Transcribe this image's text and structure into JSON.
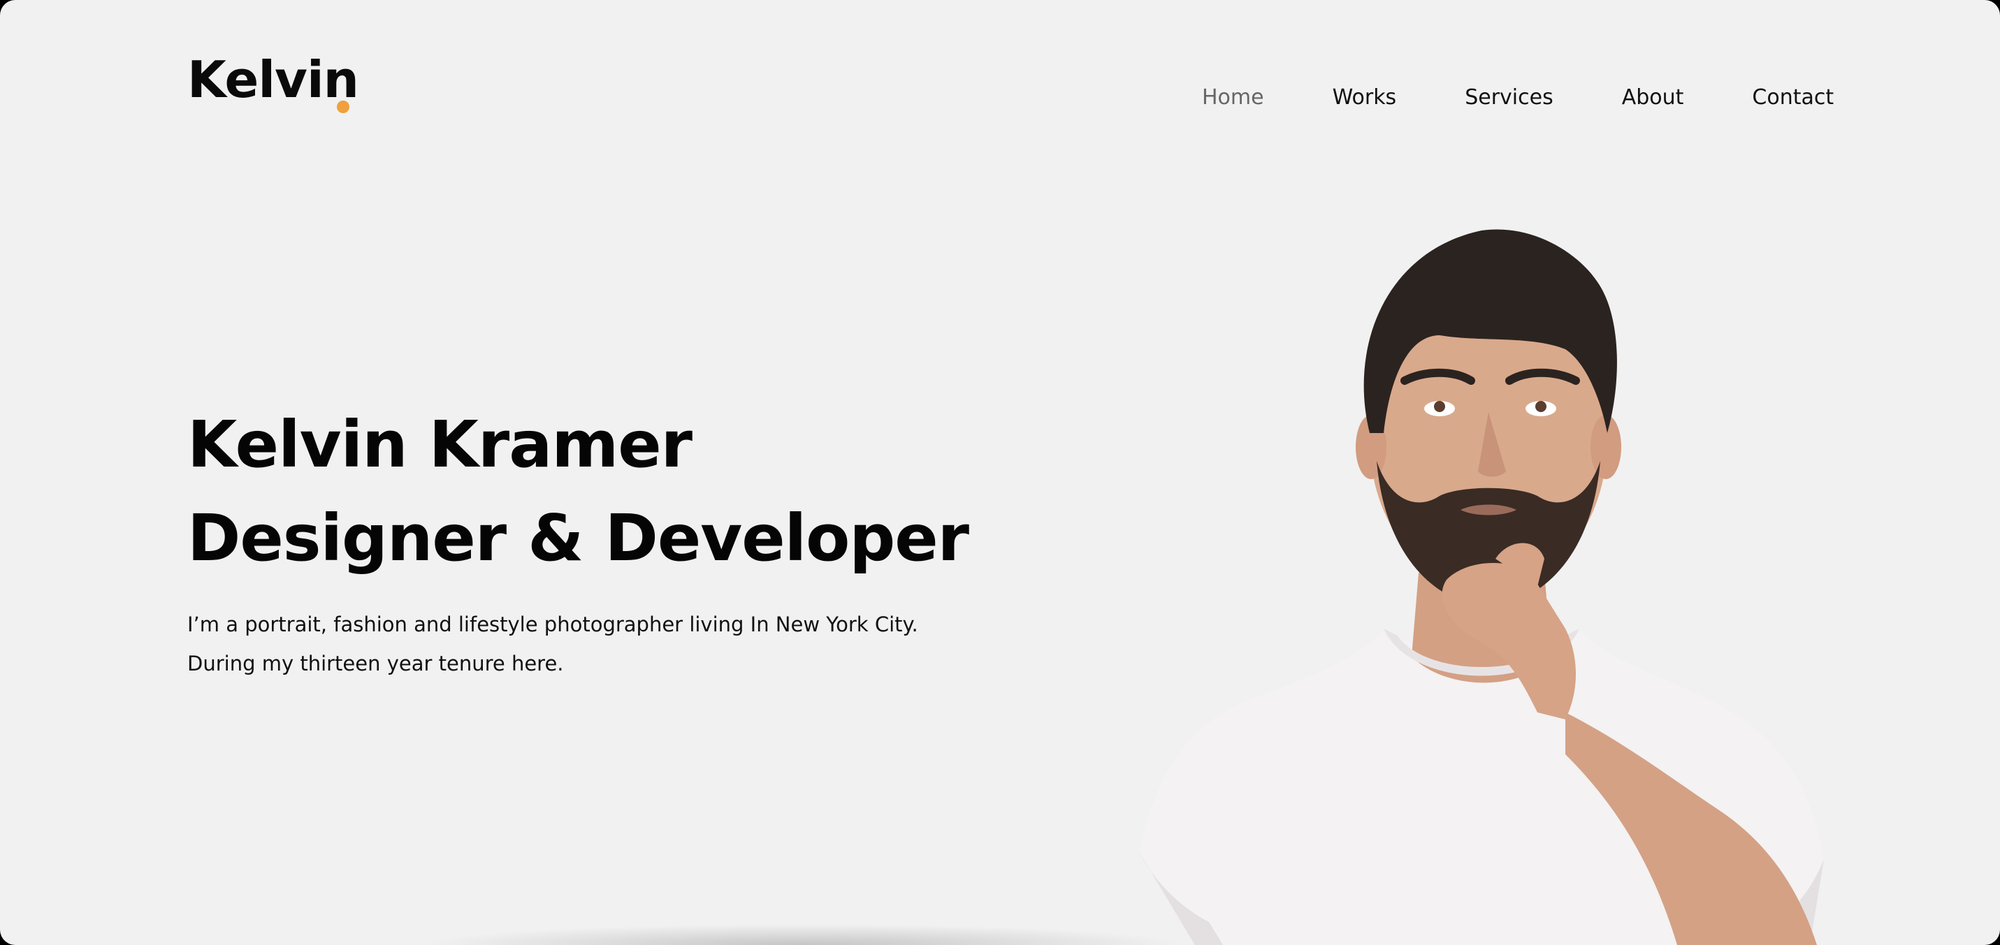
{
  "brand": {
    "name": "Kelvin",
    "accent_color": "#f0a03c"
  },
  "nav": {
    "items": [
      {
        "label": "Home",
        "active": true
      },
      {
        "label": "Works",
        "active": false
      },
      {
        "label": "Services",
        "active": false
      },
      {
        "label": "About",
        "active": false
      },
      {
        "label": "Contact",
        "active": false
      }
    ]
  },
  "hero": {
    "title_line1": "Kelvin Kramer",
    "title_line2": "Designer & Developer",
    "desc_line1": "I’m a portrait, fashion and lifestyle photographer living In New York City.",
    "desc_line2": "During my thirteen year tenure here."
  },
  "portrait": {
    "icon": "person-thinking-portrait",
    "shirt_color": "#f4f2f3",
    "skin_color": "#d9a98c",
    "hair_color": "#2b2320"
  }
}
